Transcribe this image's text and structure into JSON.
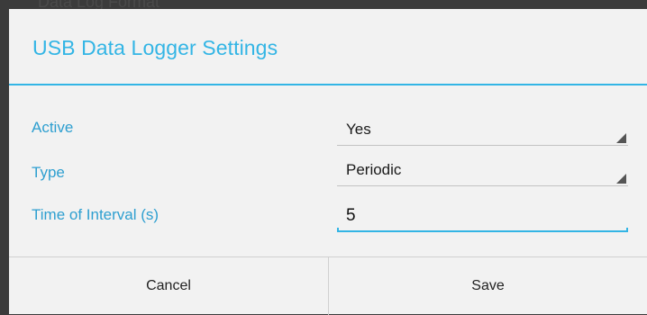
{
  "backdrop": {
    "partial_text": "Data Log Format"
  },
  "dialog": {
    "title": "USB Data Logger Settings",
    "fields": {
      "active": {
        "label": "Active",
        "value": "Yes"
      },
      "type": {
        "label": "Type",
        "value": "Periodic"
      },
      "interval": {
        "label": "Time of Interval (s)",
        "value": "5"
      }
    },
    "buttons": {
      "cancel": "Cancel",
      "save": "Save"
    }
  },
  "colors": {
    "accent": "#33b5e5",
    "dialog_background": "#f2f2f2",
    "backdrop": "#3b3b3b"
  }
}
